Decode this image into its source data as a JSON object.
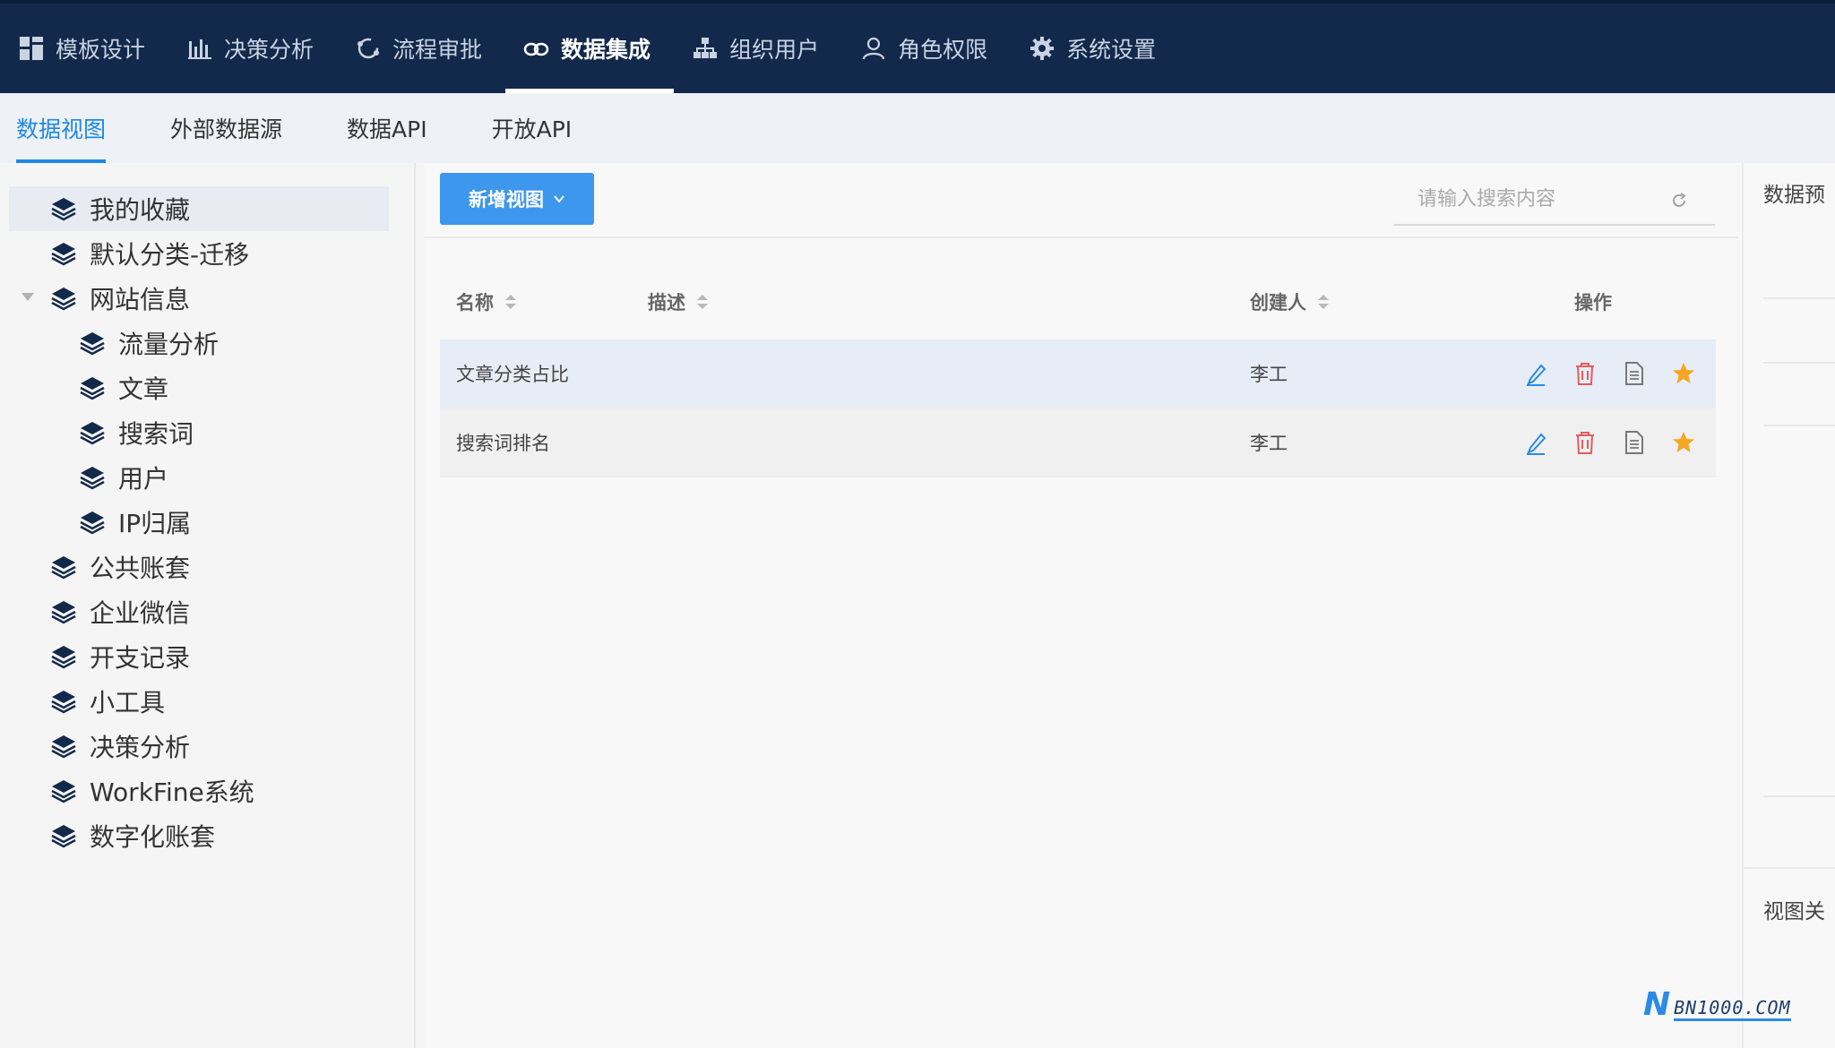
{
  "topnav": {
    "items": [
      {
        "label": "模板设计",
        "icon": "grid-icon",
        "active": false
      },
      {
        "label": "决策分析",
        "icon": "bar-chart-icon",
        "active": false
      },
      {
        "label": "流程审批",
        "icon": "flow-cycle-icon",
        "active": false
      },
      {
        "label": "数据集成",
        "icon": "cloud-link-icon",
        "active": true
      },
      {
        "label": "组织用户",
        "icon": "org-tree-icon",
        "active": false
      },
      {
        "label": "角色权限",
        "icon": "user-icon",
        "active": false
      },
      {
        "label": "系统设置",
        "icon": "gear-icon",
        "active": false
      }
    ]
  },
  "subtabs": [
    "数据视图",
    "外部数据源",
    "数据API",
    "开放API"
  ],
  "sidebar": {
    "items": [
      {
        "label": "我的收藏",
        "level": 0,
        "selected": true
      },
      {
        "label": "默认分类-迁移",
        "level": 0
      },
      {
        "label": "网站信息",
        "level": 0,
        "expanded": true
      },
      {
        "label": "流量分析",
        "level": 1
      },
      {
        "label": "文章",
        "level": 1
      },
      {
        "label": "搜索词",
        "level": 1
      },
      {
        "label": "用户",
        "level": 1
      },
      {
        "label": "IP归属",
        "level": 1
      },
      {
        "label": "公共账套",
        "level": 0
      },
      {
        "label": "企业微信",
        "level": 0
      },
      {
        "label": "开支记录",
        "level": 0
      },
      {
        "label": "小工具",
        "level": 0
      },
      {
        "label": "决策分析",
        "level": 0
      },
      {
        "label": "WorkFine系统",
        "level": 0
      },
      {
        "label": "数字化账套",
        "level": 0
      }
    ]
  },
  "main": {
    "new_button": "新增视图",
    "search_placeholder": "请输入搜索内容",
    "table": {
      "headers": {
        "name": "名称",
        "desc": "描述",
        "creator": "创建人",
        "actions": "操作"
      },
      "rows": [
        {
          "name": "文章分类占比",
          "desc": "",
          "creator": "李工"
        },
        {
          "name": "搜索词排名",
          "desc": "",
          "creator": "李工"
        }
      ]
    }
  },
  "right_panel": {
    "title_top": "数据预",
    "title_bottom": "视图关"
  },
  "watermark": {
    "logo": "N",
    "text": "BN1000.COM"
  },
  "colors": {
    "nav_bg": "#13294b",
    "accent": "#1e88e5",
    "button": "#3d97ec",
    "edit": "#2b8be6",
    "delete": "#e85a5a",
    "star": "#f5a623"
  }
}
